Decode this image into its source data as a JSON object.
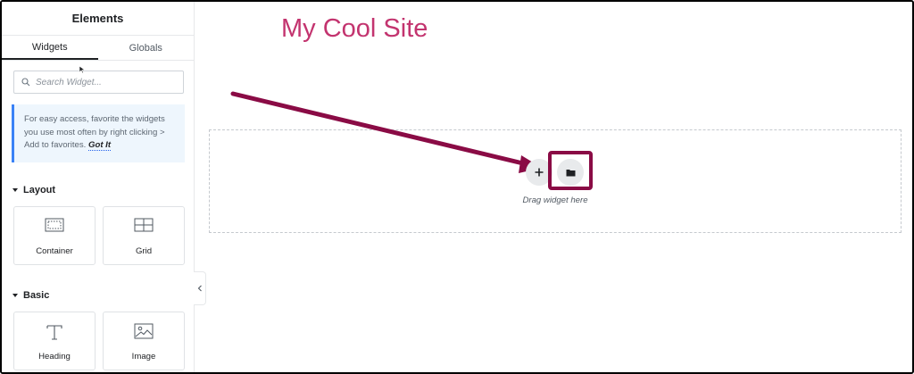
{
  "panel": {
    "title": "Elements"
  },
  "tabs": [
    {
      "label": "Widgets"
    },
    {
      "label": "Globals"
    }
  ],
  "search": {
    "placeholder": "Search Widget..."
  },
  "tip": {
    "text": "For easy access, favorite the widgets you use most often by right clicking > Add to favorites.",
    "link": "Got It"
  },
  "sections": [
    {
      "label": "Layout",
      "widgets": [
        {
          "label": "Container",
          "icon": "container-icon"
        },
        {
          "label": "Grid",
          "icon": "grid-icon"
        }
      ]
    },
    {
      "label": "Basic",
      "widgets": [
        {
          "label": "Heading",
          "icon": "heading-icon"
        },
        {
          "label": "Image",
          "icon": "image-icon"
        }
      ]
    }
  ],
  "canvas": {
    "site_title": "My Cool Site",
    "drag_text": "Drag widget here"
  },
  "colors": {
    "accent": "#c3346f",
    "annotation": "#8a0b45",
    "tip_border": "#3b82f6"
  }
}
